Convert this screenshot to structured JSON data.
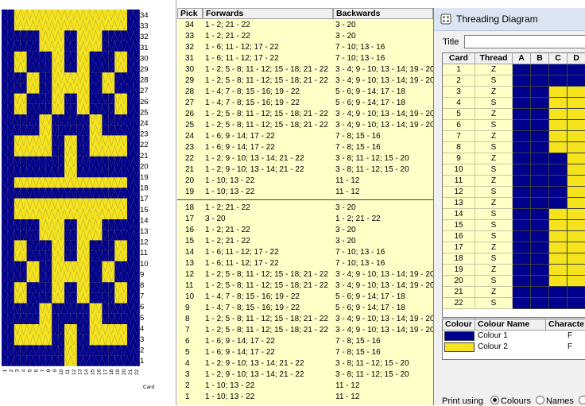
{
  "colors": {
    "blue": "#00008c",
    "yellow": "#f5e31e",
    "table_bg": "#ffffc8"
  },
  "pattern": {
    "row_numbers": [
      "34",
      "33",
      "32",
      "31",
      "30",
      "29",
      "28",
      "27",
      "26",
      "25",
      "24",
      "23",
      "22",
      "21",
      "20",
      "19",
      "18",
      "17",
      "15",
      "14",
      "13",
      "12",
      "11",
      "10",
      "9",
      "8",
      "7",
      "6",
      "5",
      "4",
      "3",
      "2",
      "1"
    ],
    "card_numbers": [
      "1",
      "2",
      "3",
      "4",
      "5",
      "6",
      "7",
      "8",
      "9",
      "10",
      "11",
      "12",
      "13",
      "14",
      "15",
      "16",
      "17",
      "18",
      "19",
      "20",
      "21",
      "22"
    ],
    "axis_label": "Card",
    "stripe_cards": [
      "1",
      "2",
      "21",
      "22"
    ]
  },
  "pick_table": {
    "headers": {
      "pick": "Pick",
      "forwards": "Forwards",
      "backwards": "Backwards"
    },
    "rows": [
      {
        "pick": "34",
        "forwards": "1 - 2; 21 - 22",
        "backwards": "3 - 20"
      },
      {
        "pick": "33",
        "forwards": "1 - 2; 21 - 22",
        "backwards": "3 - 20"
      },
      {
        "pick": "32",
        "forwards": "1 - 6; 11 - 12; 17 - 22",
        "backwards": "7 - 10; 13 - 16"
      },
      {
        "pick": "31",
        "forwards": "1 - 6; 11 - 12; 17 - 22",
        "backwards": "7 - 10; 13 - 16"
      },
      {
        "pick": "30",
        "forwards": "1 - 2; 5 - 8; 11 - 12; 15 - 18; 21 - 22",
        "backwards": "3 - 4; 9 - 10; 13 - 14; 19 - 20"
      },
      {
        "pick": "29",
        "forwards": "1 - 2; 5 - 8; 11 - 12; 15 - 18; 21 - 22",
        "backwards": "3 - 4; 9 - 10; 13 - 14; 19 - 20"
      },
      {
        "pick": "28",
        "forwards": "1 - 4; 7 - 8; 15 - 16; 19 - 22",
        "backwards": "5 - 6; 9 - 14; 17 - 18"
      },
      {
        "pick": "27",
        "forwards": "1 - 4; 7 - 8; 15 - 16; 19 - 22",
        "backwards": "5 - 6; 9 - 14; 17 - 18"
      },
      {
        "pick": "26",
        "forwards": "1 - 2; 5 - 8; 11 - 12; 15 - 18; 21 - 22",
        "backwards": "3 - 4; 9 - 10; 13 - 14; 19 - 20"
      },
      {
        "pick": "25",
        "forwards": "1 - 2; 5 - 8; 11 - 12; 15 - 18; 21 - 22",
        "backwards": "3 - 4; 9 - 10; 13 - 14; 19 - 20"
      },
      {
        "pick": "24",
        "forwards": "1 - 6; 9 - 14; 17 - 22",
        "backwards": "7 - 8; 15 - 16"
      },
      {
        "pick": "23",
        "forwards": "1 - 6; 9 - 14; 17 - 22",
        "backwards": "7 - 8; 15 - 16"
      },
      {
        "pick": "22",
        "forwards": "1 - 2; 9 - 10; 13 - 14; 21 - 22",
        "backwards": "3 - 8; 11 - 12; 15 - 20"
      },
      {
        "pick": "21",
        "forwards": "1 - 2; 9 - 10; 13 - 14; 21 - 22",
        "backwards": "3 - 8; 11 - 12; 15 - 20"
      },
      {
        "pick": "20",
        "forwards": "1 - 10; 13 - 22",
        "backwards": "11 - 12"
      },
      {
        "pick": "19",
        "forwards": "1 - 10; 13 - 22",
        "backwards": "11 - 12"
      },
      {
        "pick": "18",
        "forwards": "1 - 2; 21 - 22",
        "backwards": "3 - 20"
      },
      {
        "pick": "17",
        "forwards": "3 - 20",
        "backwards": "1 - 2; 21 - 22"
      },
      {
        "pick": "16",
        "forwards": "1 - 2; 21 - 22",
        "backwards": "3 - 20"
      },
      {
        "pick": "15",
        "forwards": "1 - 2; 21 - 22",
        "backwards": "3 - 20"
      },
      {
        "pick": "14",
        "forwards": "1 - 6; 11 - 12; 17 - 22",
        "backwards": "7 - 10; 13 - 16"
      },
      {
        "pick": "13",
        "forwards": "1 - 6; 11 - 12; 17 - 22",
        "backwards": "7 - 10; 13 - 16"
      },
      {
        "pick": "12",
        "forwards": "1 - 2; 5 - 8; 11 - 12; 15 - 18; 21 - 22",
        "backwards": "3 - 4; 9 - 10; 13 - 14; 19 - 20"
      },
      {
        "pick": "11",
        "forwards": "1 - 2; 5 - 8; 11 - 12; 15 - 18; 21 - 22",
        "backwards": "3 - 4; 9 - 10; 13 - 14; 19 - 20"
      },
      {
        "pick": "10",
        "forwards": "1 - 4; 7 - 8; 15 - 16; 19 - 22",
        "backwards": "5 - 6; 9 - 14; 17 - 18"
      },
      {
        "pick": "9",
        "forwards": "1 - 4; 7 - 8; 15 - 16; 19 - 22",
        "backwards": "5 - 6; 9 - 14; 17 - 18"
      },
      {
        "pick": "8",
        "forwards": "1 - 2; 5 - 8; 11 - 12; 15 - 18; 21 - 22",
        "backwards": "3 - 4; 9 - 10; 13 - 14; 19 - 20"
      },
      {
        "pick": "7",
        "forwards": "1 - 2; 5 - 8; 11 - 12; 15 - 18; 21 - 22",
        "backwards": "3 - 4; 9 - 10; 13 - 14; 19 - 20"
      },
      {
        "pick": "6",
        "forwards": "1 - 6; 9 - 14; 17 - 22",
        "backwards": "7 - 8; 15 - 16"
      },
      {
        "pick": "5",
        "forwards": "1 - 6; 9 - 14; 17 - 22",
        "backwards": "7 - 8; 15 - 16"
      },
      {
        "pick": "4",
        "forwards": "1 - 2; 9 - 10; 13 - 14; 21 - 22",
        "backwards": "3 - 8; 11 - 12; 15 - 20"
      },
      {
        "pick": "3",
        "forwards": "1 - 2; 9 - 10; 13 - 14; 21 - 22",
        "backwards": "3 - 8; 11 - 12; 15 - 20"
      },
      {
        "pick": "2",
        "forwards": "1 - 10; 13 - 22",
        "backwards": "11 - 12"
      },
      {
        "pick": "1",
        "forwards": "1 - 10; 13 - 22",
        "backwards": "11 - 12"
      }
    ]
  },
  "threading": {
    "window_title": "Threading Diagram",
    "title_label": "Title",
    "title_value": "",
    "headers": [
      "Card",
      "Thread",
      "A",
      "B",
      "C",
      "D"
    ],
    "cards": [
      {
        "card": "1",
        "thread": "Z",
        "holes": [
          "blue",
          "blue",
          "blue",
          "blue"
        ]
      },
      {
        "card": "2",
        "thread": "S",
        "holes": [
          "blue",
          "blue",
          "blue",
          "blue"
        ]
      },
      {
        "card": "3",
        "thread": "Z",
        "holes": [
          "blue",
          "blue",
          "yellow",
          "yellow"
        ]
      },
      {
        "card": "4",
        "thread": "S",
        "holes": [
          "blue",
          "blue",
          "yellow",
          "yellow"
        ]
      },
      {
        "card": "5",
        "thread": "Z",
        "holes": [
          "blue",
          "blue",
          "yellow",
          "yellow"
        ]
      },
      {
        "card": "6",
        "thread": "S",
        "holes": [
          "blue",
          "blue",
          "yellow",
          "yellow"
        ]
      },
      {
        "card": "7",
        "thread": "Z",
        "holes": [
          "blue",
          "blue",
          "yellow",
          "yellow"
        ]
      },
      {
        "card": "8",
        "thread": "S",
        "holes": [
          "blue",
          "blue",
          "yellow",
          "yellow"
        ]
      },
      {
        "card": "9",
        "thread": "Z",
        "holes": [
          "blue",
          "blue",
          "blue",
          "yellow"
        ]
      },
      {
        "card": "10",
        "thread": "S",
        "holes": [
          "blue",
          "blue",
          "blue",
          "yellow"
        ]
      },
      {
        "card": "11",
        "thread": "Z",
        "holes": [
          "blue",
          "blue",
          "blue",
          "yellow"
        ]
      },
      {
        "card": "12",
        "thread": "S",
        "holes": [
          "blue",
          "blue",
          "blue",
          "yellow"
        ]
      },
      {
        "card": "13",
        "thread": "Z",
        "holes": [
          "blue",
          "blue",
          "blue",
          "yellow"
        ]
      },
      {
        "card": "14",
        "thread": "S",
        "holes": [
          "blue",
          "blue",
          "yellow",
          "yellow"
        ]
      },
      {
        "card": "15",
        "thread": "S",
        "holes": [
          "blue",
          "blue",
          "yellow",
          "yellow"
        ]
      },
      {
        "card": "16",
        "thread": "S",
        "holes": [
          "blue",
          "blue",
          "yellow",
          "yellow"
        ]
      },
      {
        "card": "17",
        "thread": "Z",
        "holes": [
          "blue",
          "blue",
          "yellow",
          "yellow"
        ]
      },
      {
        "card": "18",
        "thread": "S",
        "holes": [
          "blue",
          "blue",
          "yellow",
          "yellow"
        ]
      },
      {
        "card": "19",
        "thread": "Z",
        "holes": [
          "blue",
          "blue",
          "yellow",
          "yellow"
        ]
      },
      {
        "card": "20",
        "thread": "S",
        "holes": [
          "blue",
          "blue",
          "yellow",
          "yellow"
        ]
      },
      {
        "card": "21",
        "thread": "Z",
        "holes": [
          "blue",
          "blue",
          "blue",
          "blue"
        ]
      },
      {
        "card": "22",
        "thread": "S",
        "holes": [
          "blue",
          "blue",
          "blue",
          "blue"
        ]
      }
    ],
    "colour_headers": [
      "Colour",
      "Colour Name",
      "Characte"
    ],
    "colours": [
      {
        "swatch": "blue",
        "name": "Colour 1",
        "char": "F"
      },
      {
        "swatch": "yellow",
        "name": "Colour 2",
        "char": "F"
      }
    ],
    "print_using_label": "Print using",
    "print_options": [
      {
        "label": "Colours",
        "selected": true
      },
      {
        "label": "Names",
        "selected": false
      },
      {
        "label": "",
        "selected": false
      }
    ]
  }
}
